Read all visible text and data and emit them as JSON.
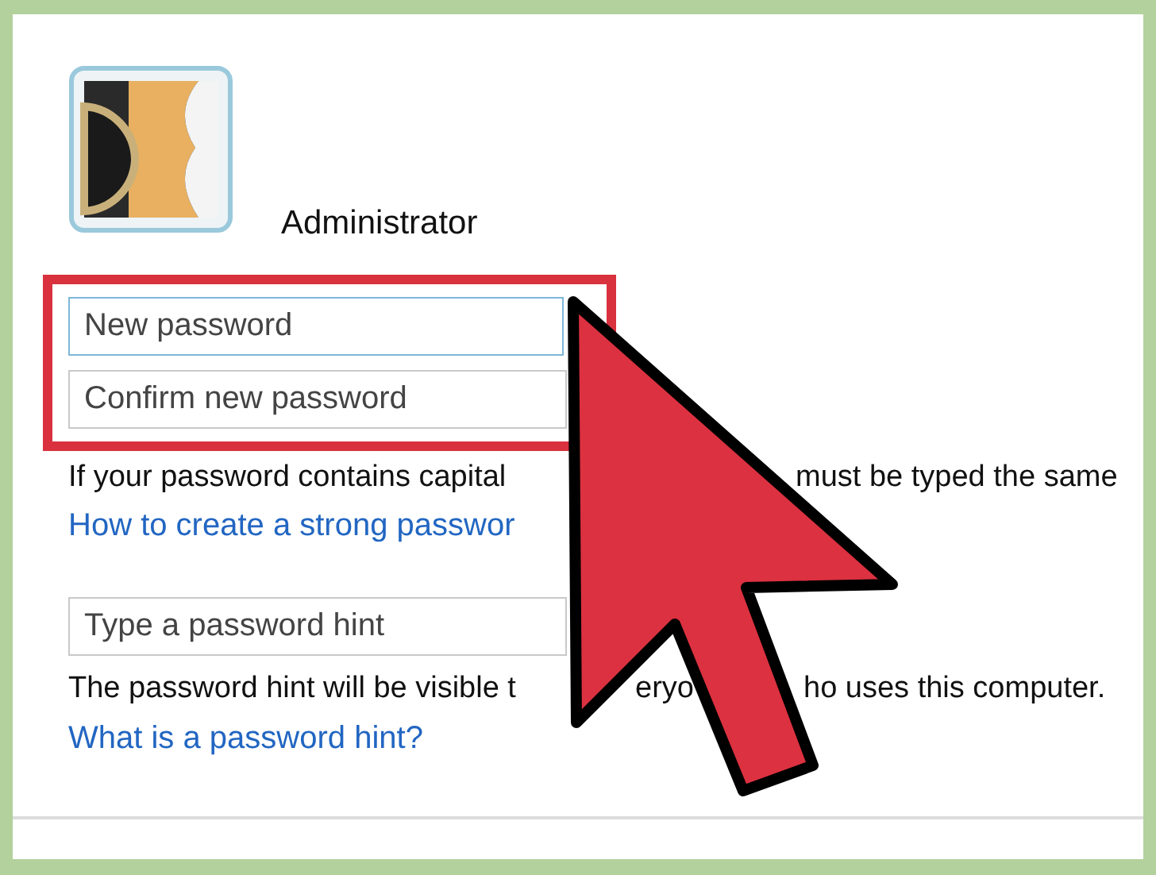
{
  "account": {
    "name": "Administrator"
  },
  "password_fields": [
    {
      "placeholder": "New password"
    },
    {
      "placeholder": "Confirm new password"
    }
  ],
  "case_note": [
    "If your password contains capital",
    "must be typed the same"
  ],
  "strong_password_link": "How to create a strong passwor",
  "hint_field": {
    "placeholder": "Type a password hint"
  },
  "hint_note": [
    "The password hint will be visible t",
    "eryo",
    "ho uses this computer."
  ],
  "hint_link": "What is a password hint?"
}
